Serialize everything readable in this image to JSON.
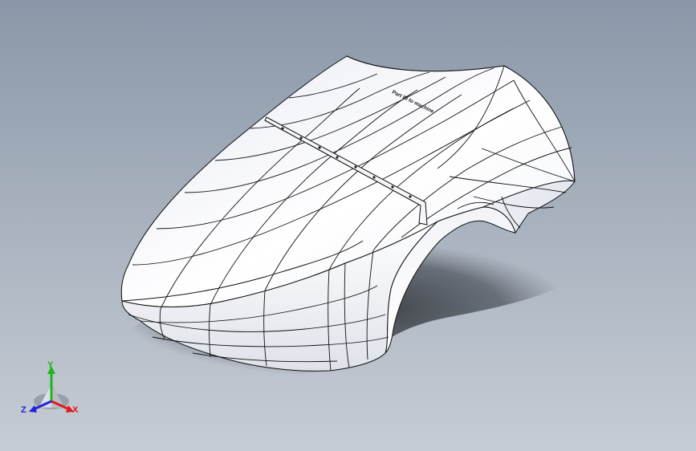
{
  "viewport": {
    "background_top": "#8b97a8",
    "background_bottom": "#c6ccd4"
  },
  "model": {
    "body_color": "#ffffff",
    "edge_color": "#101010",
    "shadow_color": "#3e434a",
    "engraved_text": "Part ID to machine"
  },
  "triad": {
    "x_label": "X",
    "y_label": "Y",
    "z_label": "Z",
    "x_color": "#e01b1b",
    "y_color": "#1db51d",
    "z_color": "#2222dd"
  }
}
